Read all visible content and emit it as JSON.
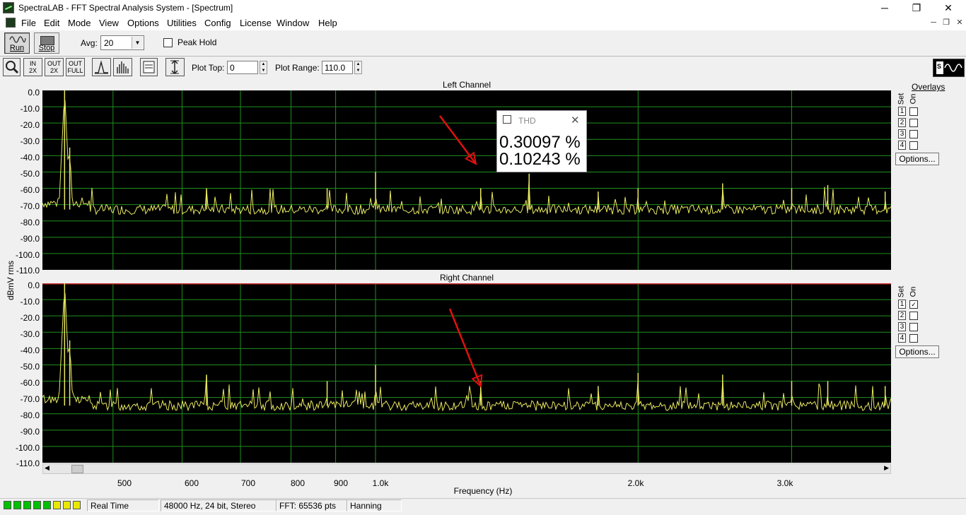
{
  "window": {
    "title": "SpectraLAB - FFT Spectral Analysis System - [Spectrum]",
    "min_glyph": "─",
    "max_glyph": "❐",
    "close_glyph": "✕",
    "mdi_min": "─",
    "mdi_restore": "❐",
    "mdi_close": "✕"
  },
  "menu": [
    "File",
    "Edit",
    "Mode",
    "View",
    "Options",
    "Utilities",
    "Config",
    "License",
    "Window",
    "Help"
  ],
  "toolbar": {
    "run_label": "Run",
    "stop_label": "Stop",
    "avg_label": "Avg:",
    "avg_value": "20",
    "avg_arrow": "▼",
    "peak_hold_label": "Peak Hold",
    "plot_top_label": "Plot Top:",
    "plot_top_value": "0",
    "plot_range_label": "Plot Range:",
    "plot_range_value": "110.0",
    "zoom_in_top": "IN",
    "zoom_in_bottom": "2X",
    "zoom_out_top": "OUT",
    "zoom_out_bottom": "2X",
    "zoom_full_top": "OUT",
    "zoom_full_bottom": "FULL",
    "icons": [
      "magnify-icon",
      "zoom-in-2x-icon",
      "zoom-out-2x-icon",
      "zoom-out-full-icon",
      "line-plot-icon",
      "bar-plot-icon",
      "display-settings-icon",
      "autoscale-icon",
      "spectralab-logo"
    ]
  },
  "overlays": {
    "title": "Overlays",
    "set_label": "Set",
    "on_label": "On",
    "rows": [
      "1",
      "2",
      "3",
      "4"
    ],
    "left_checked": [
      false,
      false,
      false,
      false
    ],
    "right_checked": [
      true,
      false,
      false,
      false
    ],
    "options_label": "Options...",
    "check_glyph": "✓"
  },
  "thd": {
    "title": "THD",
    "left": "0.30097 %",
    "right": "0.10243 %",
    "close": "✕"
  },
  "scroll": {
    "left_arrow": "◀",
    "right_arrow": "▶"
  },
  "status": {
    "mode": "Real Time",
    "format": "48000 Hz, 24 bit, Stereo",
    "fft": "FFT: 65536 pts",
    "window": "Hanning",
    "meter_colors": [
      "#00c000",
      "#00c000",
      "#00c000",
      "#00c000",
      "#00c000",
      "#e8e800",
      "#e8e800",
      "#e8e800"
    ]
  },
  "colors": {
    "trace": "#e8e860",
    "grid": "#1f8f1f",
    "arrow": "#e01010",
    "right_topline": "#d03030"
  },
  "chart_data": {
    "type": "line",
    "xlabel": "Frequency (Hz)",
    "ylabel": "dBmV rms",
    "x_scale": "log",
    "xlim": [
      415,
      3900
    ],
    "ylim": [
      -110,
      0
    ],
    "x_ticks": [
      {
        "value": 500,
        "label": "500"
      },
      {
        "value": 600,
        "label": "600"
      },
      {
        "value": 700,
        "label": "700"
      },
      {
        "value": 800,
        "label": "800"
      },
      {
        "value": 900,
        "label": "900"
      },
      {
        "value": 1000,
        "label": "1.0k"
      },
      {
        "value": 2000,
        "label": "2.0k"
      },
      {
        "value": 3000,
        "label": "3.0k"
      }
    ],
    "y_ticks": [
      "0.0",
      "-10.0",
      "-20.0",
      "-30.0",
      "-40.0",
      "-50.0",
      "-60.0",
      "-70.0",
      "-80.0",
      "-90.0",
      "-100.0",
      "-110.0"
    ],
    "grid": true,
    "series": [
      {
        "name": "Left Channel",
        "noise_floor": -73,
        "peaks": [
          {
            "f": 440,
            "db": 0
          },
          {
            "f": 446,
            "db": -35
          },
          {
            "f": 640,
            "db": -60
          },
          {
            "f": 880,
            "db": -60
          },
          {
            "f": 1000,
            "db": -50
          },
          {
            "f": 1320,
            "db": -60
          },
          {
            "f": 1500,
            "db": -51
          },
          {
            "f": 1800,
            "db": -62
          },
          {
            "f": 2000,
            "db": -60
          },
          {
            "f": 2500,
            "db": -57
          },
          {
            "f": 3000,
            "db": -60
          },
          {
            "f": 3300,
            "db": -58
          },
          {
            "f": 3840,
            "db": -62
          }
        ]
      },
      {
        "name": "Right Channel",
        "noise_floor": -75,
        "peaks": [
          {
            "f": 440,
            "db": 0
          },
          {
            "f": 446,
            "db": -35
          },
          {
            "f": 640,
            "db": -56
          },
          {
            "f": 880,
            "db": -60
          },
          {
            "f": 1000,
            "db": -50
          },
          {
            "f": 1320,
            "db": -60
          },
          {
            "f": 1800,
            "db": -63
          },
          {
            "f": 2000,
            "db": -55
          },
          {
            "f": 2500,
            "db": -56
          },
          {
            "f": 3000,
            "db": -60
          },
          {
            "f": 3300,
            "db": -60
          },
          {
            "f": 3840,
            "db": -63
          }
        ]
      }
    ]
  }
}
